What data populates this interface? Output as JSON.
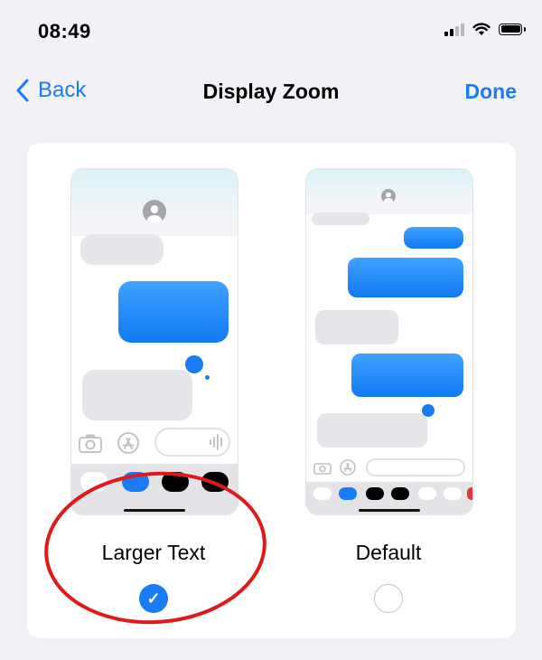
{
  "status_bar": {
    "time": "08:49",
    "icons": [
      "cellular-signal-icon",
      "wifi-icon",
      "battery-icon"
    ]
  },
  "nav": {
    "back_label": "Back",
    "title": "Display Zoom",
    "done_label": "Done"
  },
  "options": [
    {
      "label": "Larger Text",
      "selected": true
    },
    {
      "label": "Default",
      "selected": false
    }
  ],
  "colors": {
    "accent": "#1a7cf5",
    "background": "#f1f1f6",
    "annotation": "#e0191c"
  }
}
